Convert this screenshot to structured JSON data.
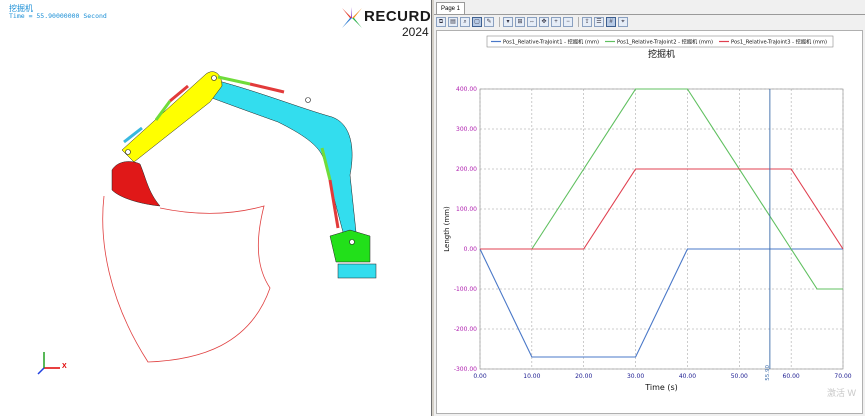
{
  "model_view": {
    "title": "挖掘机",
    "time_label": "Time = 55.90000000 Second",
    "logo_brand": "RECURDYN",
    "logo_year": "2024",
    "axis_x_label": "X",
    "colors": {
      "boom": "#ffff00",
      "arm": "#33ddee",
      "bucket": "#e01818",
      "pedestal": "#22e01a",
      "cylinder_rod": "#6fdc3a",
      "cylinder_barrel": "#e23a3a",
      "trace": "#e04040"
    }
  },
  "plot_window": {
    "tab_label": "Page 1",
    "toolbar_icons": [
      "copy-icon",
      "paste-icon",
      "zoom-icon",
      "select-icon",
      "draw-icon",
      "dropdown-icon",
      "fit-icon",
      "fit-x-icon",
      "pan-icon",
      "zoom-in-icon",
      "zoom-out-icon",
      "export-icon",
      "legend-icon",
      "grid-icon",
      "cursor-icon"
    ],
    "watermark": "激活 W"
  },
  "chart_data": {
    "type": "line",
    "title": "挖掘机",
    "xlabel": "Time (s)",
    "ylabel": "Length (mm)",
    "xlim": [
      0,
      70
    ],
    "ylim": [
      -300,
      400
    ],
    "grid": true,
    "legend_position": "top",
    "x_ticks": [
      "0.00",
      "10.00",
      "20.00",
      "30.00",
      "40.00",
      "50.00",
      "60.00",
      "70.00"
    ],
    "y_ticks": [
      "400.00",
      "300.00",
      "200.00",
      "100.00",
      "0.00",
      "-100.00",
      "-200.00",
      "-300.00"
    ],
    "cursor": {
      "x": 55.9,
      "label": "55.90"
    },
    "series": [
      {
        "name": "Pos1_Relative-TraJoint1 - 挖掘机 (mm)",
        "color": "#4a78c8",
        "x": [
          0,
          10,
          30,
          40,
          70
        ],
        "y": [
          0,
          -270,
          -270,
          0,
          0
        ]
      },
      {
        "name": "Pos1_Relative-TraJoint2 - 挖掘机 (mm)",
        "color": "#60c060",
        "x": [
          0,
          10,
          30,
          40,
          60,
          65,
          70
        ],
        "y": [
          0,
          0,
          400,
          400,
          0,
          -100,
          -100
        ]
      },
      {
        "name": "Pos1_Relative-TraJoint3 - 挖掘机 (mm)",
        "color": "#e04050",
        "x": [
          0,
          20,
          30,
          60,
          70
        ],
        "y": [
          0,
          0,
          200,
          200,
          0
        ]
      }
    ]
  }
}
